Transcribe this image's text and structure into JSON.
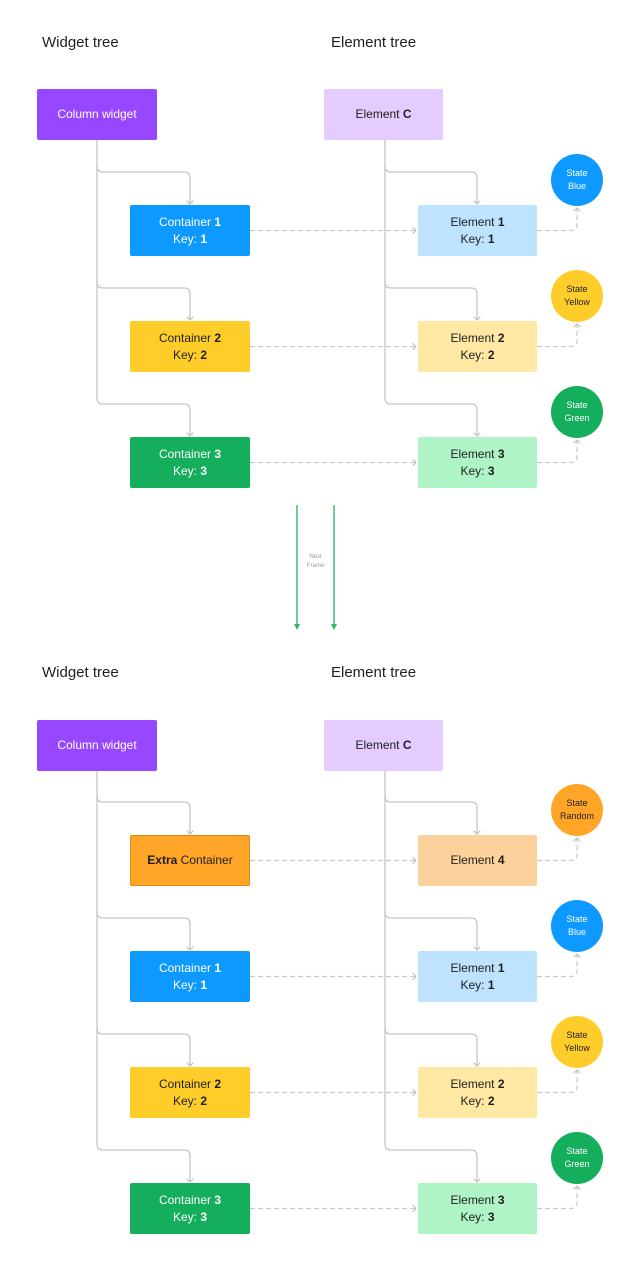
{
  "colors": {
    "connector": "#C6C6C6",
    "dashed_link": "#C9C9C9",
    "next_frame_arrow": "#2DB86A",
    "title_text": "#1E1E1E"
  },
  "transition": {
    "line1": "Next",
    "line2": "Frame"
  },
  "frames": [
    {
      "widget_tree_title": "Widget tree",
      "element_tree_title": "Element tree",
      "widget_root": {
        "label": {
          "pre": "Column widget",
          "bold": "",
          "post": ""
        },
        "bg": "#9747FF",
        "fg": "#FFFFFF"
      },
      "element_root": {
        "label": {
          "pre": "Element ",
          "bold": "C",
          "post": ""
        },
        "bg": "#E4CCFF",
        "fg": "#1E1E1E"
      },
      "rows": [
        {
          "widget": {
            "line1": {
              "pre": "Container ",
              "bold": "1"
            },
            "line2": {
              "pre": "Key: ",
              "bold": "1"
            },
            "bg": "#0D99FF",
            "fg": "#FFFFFF"
          },
          "element": {
            "line1": {
              "pre": "Element ",
              "bold": "1"
            },
            "line2": {
              "pre": "Key: ",
              "bold": "1"
            },
            "bg": "#BDE3FF",
            "fg": "#1E1E1E"
          },
          "state": {
            "line1": "State",
            "line2": "Blue",
            "bg": "#0D99FF",
            "fg": "#FFFFFF"
          }
        },
        {
          "widget": {
            "line1": {
              "pre": "Container ",
              "bold": "2"
            },
            "line2": {
              "pre": "Key: ",
              "bold": "2"
            },
            "bg": "#FFCD29",
            "fg": "#1E1E1E"
          },
          "element": {
            "line1": {
              "pre": "Element ",
              "bold": "2"
            },
            "line2": {
              "pre": "Key: ",
              "bold": "2"
            },
            "bg": "#FFE8A3",
            "fg": "#1E1E1E"
          },
          "state": {
            "line1": "State",
            "line2": "Yellow",
            "bg": "#FFCD29",
            "fg": "#1E1E1E"
          }
        },
        {
          "widget": {
            "line1": {
              "pre": "Container ",
              "bold": "3"
            },
            "line2": {
              "pre": "Key: ",
              "bold": "3"
            },
            "bg": "#14AE5C",
            "fg": "#FFFFFF"
          },
          "element": {
            "line1": {
              "pre": "Element ",
              "bold": "3"
            },
            "line2": {
              "pre": "Key: ",
              "bold": "3"
            },
            "bg": "#AFF4C6",
            "fg": "#1E1E1E"
          },
          "state": {
            "line1": "State",
            "line2": "Green",
            "bg": "#14AE5C",
            "fg": "#FFFFFF"
          }
        }
      ]
    },
    {
      "widget_tree_title": "Widget tree",
      "element_tree_title": "Element tree",
      "widget_root": {
        "label": {
          "pre": "Column widget",
          "bold": "",
          "post": ""
        },
        "bg": "#9747FF",
        "fg": "#FFFFFF"
      },
      "element_root": {
        "label": {
          "pre": "Element ",
          "bold": "C",
          "post": ""
        },
        "bg": "#E4CCFF",
        "fg": "#1E1E1E"
      },
      "rows": [
        {
          "widget": {
            "line1": {
              "pre": "",
              "bold": "Extra",
              "post": " Container"
            },
            "bg": "#FFA629",
            "fg": "#1E1E1E",
            "border": "#E08A12"
          },
          "element": {
            "line1": {
              "pre": "Element ",
              "bold": "4"
            },
            "bg": "#FCD19C",
            "fg": "#1E1E1E"
          },
          "state": {
            "line1": "State",
            "line2": "Random",
            "bg": "#FFA629",
            "fg": "#1E1E1E"
          }
        },
        {
          "widget": {
            "line1": {
              "pre": "Container ",
              "bold": "1"
            },
            "line2": {
              "pre": "Key: ",
              "bold": "1"
            },
            "bg": "#0D99FF",
            "fg": "#FFFFFF"
          },
          "element": {
            "line1": {
              "pre": "Element ",
              "bold": "1"
            },
            "line2": {
              "pre": "Key: ",
              "bold": "1"
            },
            "bg": "#BDE3FF",
            "fg": "#1E1E1E"
          },
          "state": {
            "line1": "State",
            "line2": "Blue",
            "bg": "#0D99FF",
            "fg": "#FFFFFF"
          }
        },
        {
          "widget": {
            "line1": {
              "pre": "Container ",
              "bold": "2"
            },
            "line2": {
              "pre": "Key: ",
              "bold": "2"
            },
            "bg": "#FFCD29",
            "fg": "#1E1E1E"
          },
          "element": {
            "line1": {
              "pre": "Element ",
              "bold": "2"
            },
            "line2": {
              "pre": "Key: ",
              "bold": "2"
            },
            "bg": "#FFE8A3",
            "fg": "#1E1E1E"
          },
          "state": {
            "line1": "State",
            "line2": "Yellow",
            "bg": "#FFCD29",
            "fg": "#1E1E1E"
          }
        },
        {
          "widget": {
            "line1": {
              "pre": "Container ",
              "bold": "3"
            },
            "line2": {
              "pre": "Key: ",
              "bold": "3"
            },
            "bg": "#14AE5C",
            "fg": "#FFFFFF"
          },
          "element": {
            "line1": {
              "pre": "Element ",
              "bold": "3"
            },
            "line2": {
              "pre": "Key: ",
              "bold": "3"
            },
            "bg": "#AFF4C6",
            "fg": "#1E1E1E"
          },
          "state": {
            "line1": "State",
            "line2": "Green",
            "bg": "#14AE5C",
            "fg": "#FFFFFF"
          }
        }
      ]
    }
  ]
}
